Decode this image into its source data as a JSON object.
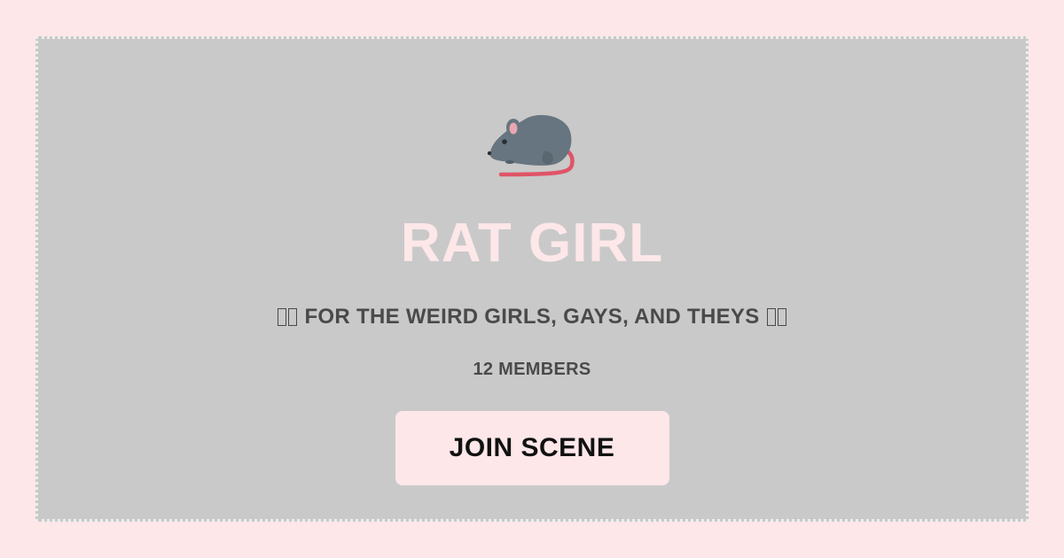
{
  "scene": {
    "icon": "rat-emoji",
    "title": "RAT GIRL",
    "tagline_text": "FOR THE WEIRD GIRLS, GAYS, AND THEYS",
    "members": "12 MEMBERS",
    "join_label": "JOIN SCENE"
  },
  "colors": {
    "page_background": "#fde7e9",
    "card_background": "#c9c9c9",
    "title": "#fde7e9",
    "text": "#4a4a4a",
    "button_background": "#fde7e9",
    "button_text": "#111111"
  }
}
